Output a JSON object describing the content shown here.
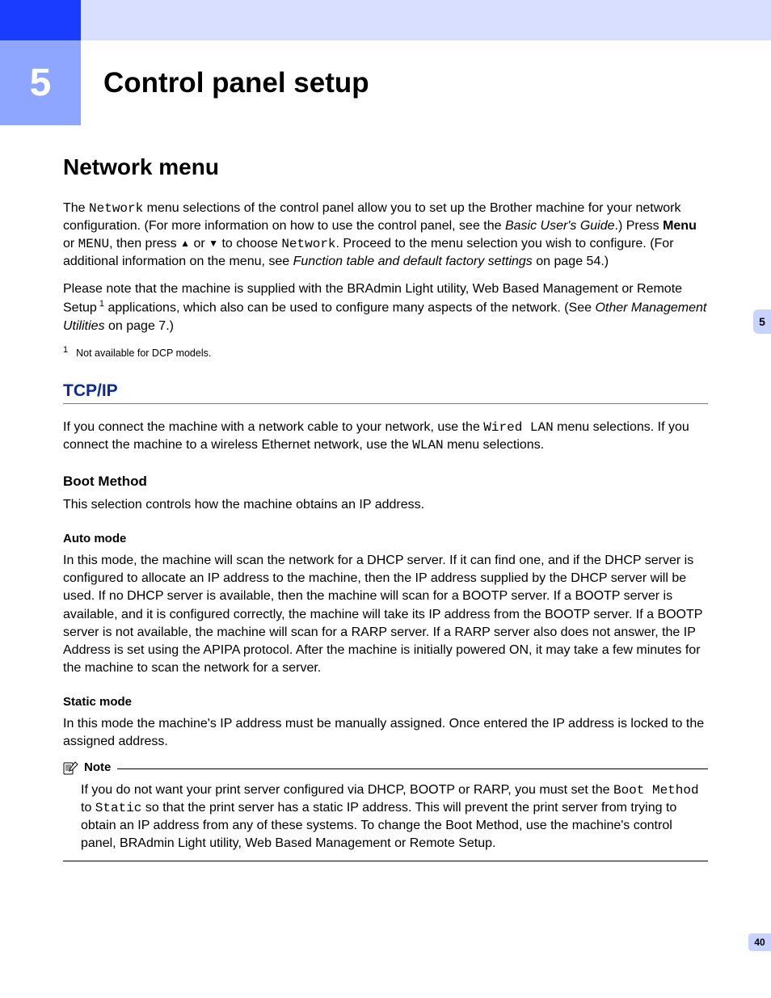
{
  "chapter": {
    "number": "5",
    "title": "Control panel setup"
  },
  "side_tab": "5",
  "page_number": "40",
  "section1": {
    "heading": "Network menu",
    "p1_seg1": "The ",
    "p1_mono1": "Network",
    "p1_seg2": " menu selections of the control panel allow you to set up the Brother machine for your network configuration. (For more information on how to use the control panel, see the ",
    "p1_ital1": "Basic User's Guide",
    "p1_seg3": ".) Press ",
    "p1_bold1": "Menu",
    "p1_seg4": " or ",
    "p1_mono2": "MENU",
    "p1_seg5": ", then press ",
    "p1_seg6": " or ",
    "p1_seg7": " to choose ",
    "p1_mono3": "Network",
    "p1_seg8": ". Proceed to the menu selection you wish to configure. (For additional information on the menu, see ",
    "p1_ital2": "Function table and default factory settings",
    "p1_seg9": " on page 54.)",
    "p2_seg1": "Please note that the machine is supplied with the BRAdmin Light utility, Web Based Management or Remote Setup",
    "p2_sup": " 1",
    "p2_seg2": " applications, which also can be used to configure many aspects of the network. (See ",
    "p2_ital1": "Other Management Utilities",
    "p2_seg3": " on page 7.)",
    "footnote_sup": "1",
    "footnote_text": "Not available for DCP models."
  },
  "tcpip": {
    "heading": "TCP/IP",
    "p1_seg1": "If you connect the machine with a network cable to your network, use the ",
    "p1_mono1": "Wired LAN",
    "p1_seg2": " menu selections. If you connect the machine to a wireless Ethernet network, use the ",
    "p1_mono2": "WLAN",
    "p1_seg3": " menu selections."
  },
  "boot": {
    "heading": "Boot Method",
    "p1": "This selection controls how the machine obtains an IP address."
  },
  "auto": {
    "heading": "Auto mode",
    "p1": "In this mode, the machine will scan the network for a DHCP server. If it can find one, and if the DHCP server is configured to allocate an IP address to the machine, then the IP address supplied by the DHCP server will be used. If no DHCP server is available, then the machine will scan for a BOOTP server. If a BOOTP server is available, and it is configured correctly, the machine will take its IP address from the BOOTP server. If a BOOTP server is not available, the machine will scan for a RARP server. If a RARP server also does not answer, the IP Address is set using the APIPA protocol. After the machine is initially powered ON, it may take a few minutes for the machine to scan the network for a server."
  },
  "static": {
    "heading": "Static mode",
    "p1": "In this mode the machine's IP address must be manually assigned. Once entered the IP address is locked to the assigned address."
  },
  "note": {
    "label": "Note",
    "seg1": "If you do not want your print server configured via DHCP, BOOTP or RARP, you must set the ",
    "mono1": "Boot Method",
    "seg2": " to ",
    "mono2": "Static",
    "seg3": " so that the print server has a static IP address. This will prevent the print server from trying to obtain an IP address from any of these systems. To change the Boot Method, use the machine's control panel, BRAdmin Light utility, Web Based Management or Remote Setup."
  }
}
